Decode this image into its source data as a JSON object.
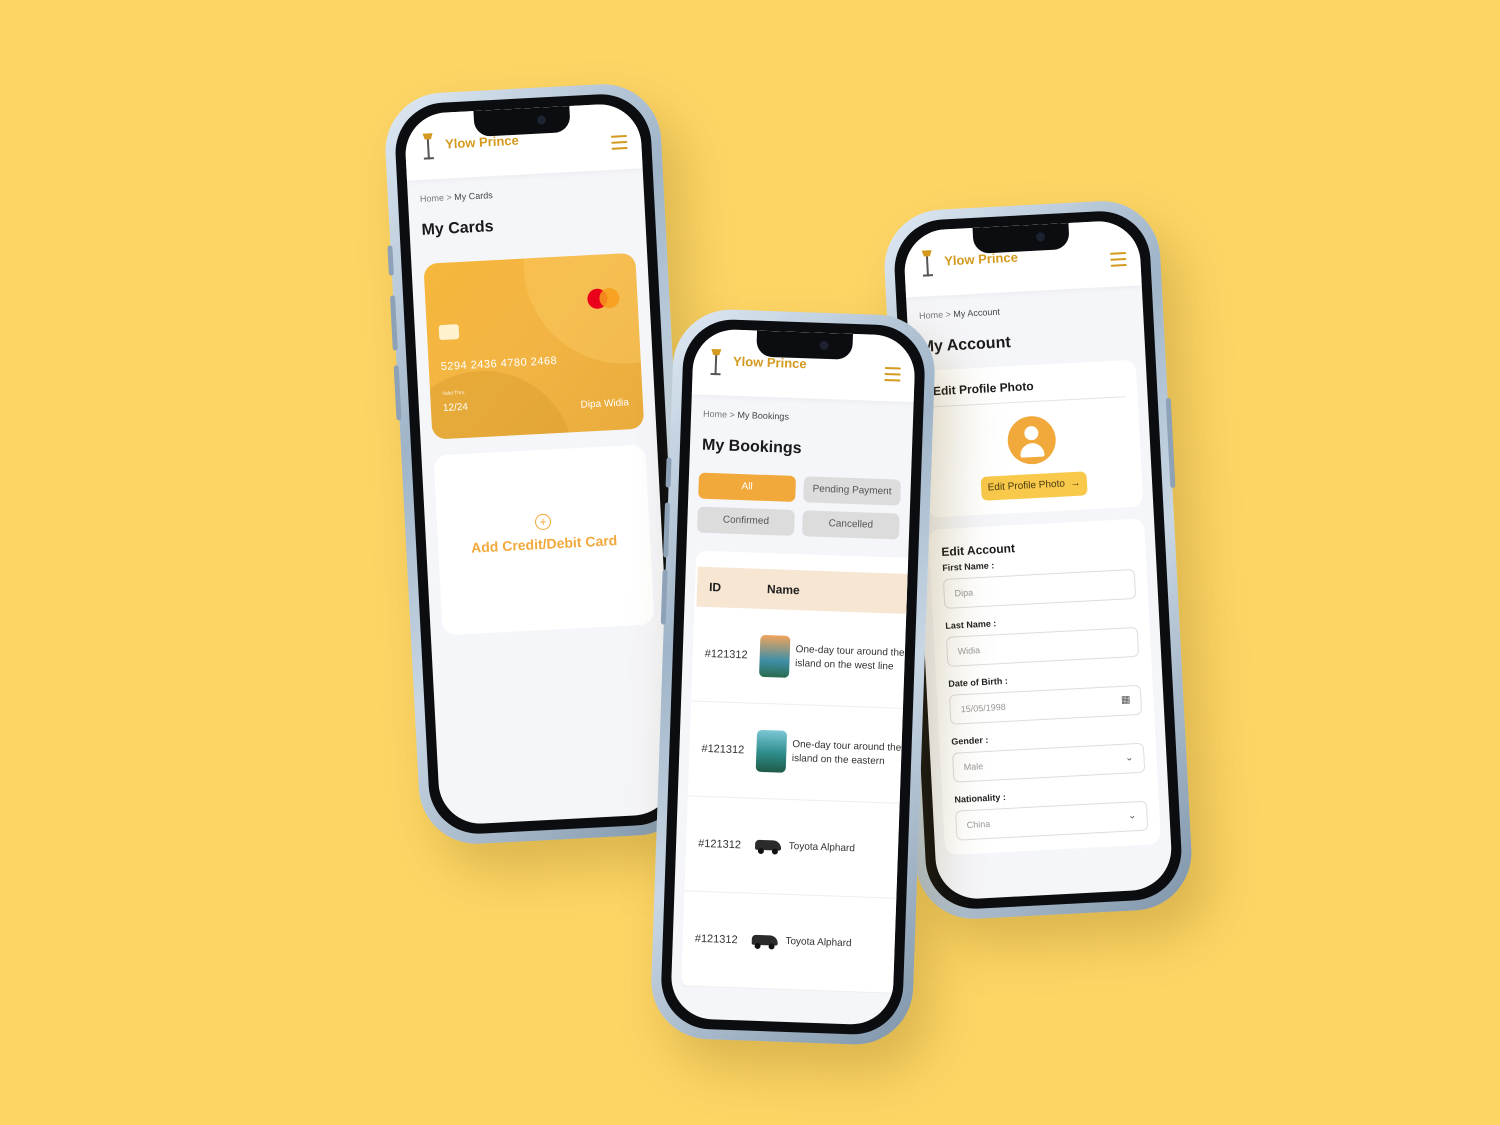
{
  "brand": {
    "name": "Ylow Prince"
  },
  "cards_screen": {
    "breadcrumb_home": "Home",
    "breadcrumb_sep": ">",
    "breadcrumb_current": "My Cards",
    "title": "My Cards",
    "card": {
      "number": "5294 2436 4780 2468",
      "valid_label": "Valid Thru",
      "expiry": "12/24",
      "holder": "Dipa Widia",
      "network": "mastercard"
    },
    "add_card_label": "Add Credit/Debit Card"
  },
  "bookings_screen": {
    "breadcrumb_home": "Home",
    "breadcrumb_sep": ">",
    "breadcrumb_current": "My Bookings",
    "title": "My Bookings",
    "filters": [
      "All",
      "Pending Payment",
      "Confirmed",
      "Cancelled"
    ],
    "active_filter": "All",
    "columns": [
      "ID",
      "Name"
    ],
    "rows": [
      {
        "id": "#121312",
        "name": "One-day tour around the island on the west line of Pen..."
      },
      {
        "id": "#121312",
        "name": "One-day tour around the island on the eastern route o..."
      },
      {
        "id": "#121312",
        "name": "Toyota Alphard"
      },
      {
        "id": "#121312",
        "name": "Toyota Alphard"
      }
    ]
  },
  "account_screen": {
    "breadcrumb_home": "Home",
    "breadcrumb_sep": ">",
    "breadcrumb_current": "My Account",
    "title": "My Account",
    "photo_section": "Edit Profile Photo",
    "photo_button": "Edit Profile Photo",
    "edit_section": "Edit Account",
    "fields": {
      "first_name_label": "First Name :",
      "first_name": "Dipa",
      "last_name_label": "Last Name :",
      "last_name": "Widia",
      "dob_label": "Date of Birth :",
      "dob": "15/05/1998",
      "gender_label": "Gender :",
      "gender": "Male",
      "nationality_label": "Nationality :",
      "nationality": "China"
    }
  },
  "colors": {
    "background": "#FDD565",
    "accent": "#F2A93B",
    "brand_text": "#D49A1F"
  }
}
